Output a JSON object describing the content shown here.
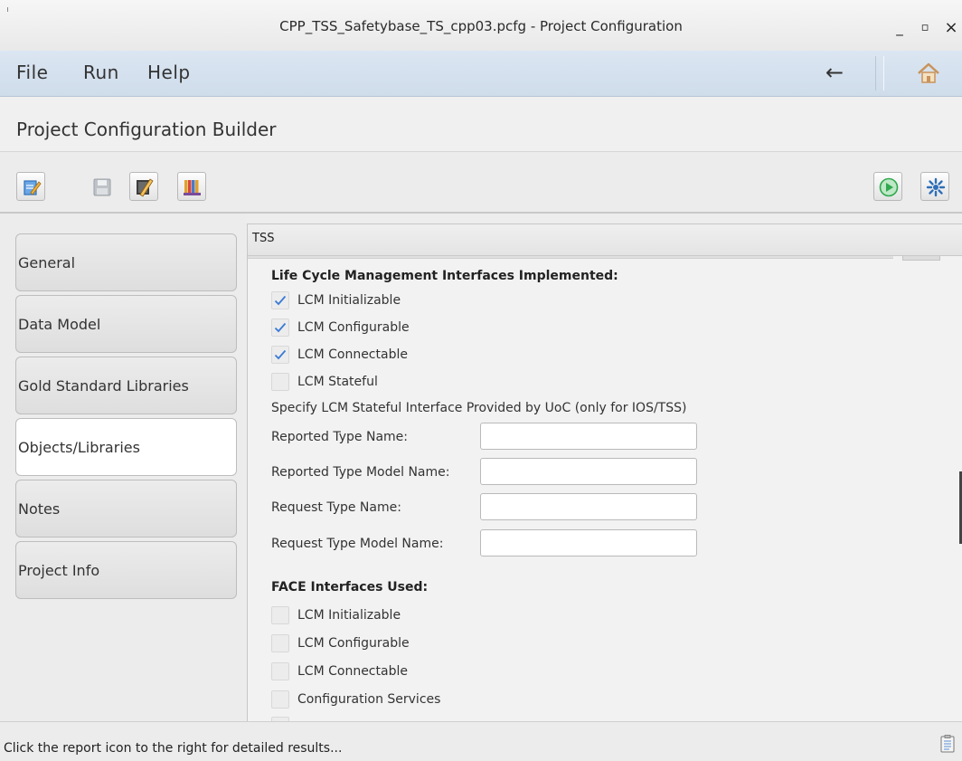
{
  "window": {
    "title": "CPP_TSS_Safetybase_TS_cpp03.pcfg - Project Configuration",
    "minimize": "_",
    "maximize": "▫",
    "close": "×"
  },
  "menubar": {
    "items": [
      "File",
      "Run",
      "Help"
    ],
    "back": "←"
  },
  "header": {
    "title": "Project Configuration Builder"
  },
  "nav": {
    "items": [
      {
        "label": "General",
        "active": false
      },
      {
        "label": "Data Model",
        "active": false
      },
      {
        "label": "Gold Standard Libraries",
        "active": false
      },
      {
        "label": "Objects/Libraries",
        "active": true
      },
      {
        "label": "Notes",
        "active": false
      },
      {
        "label": "Project Info",
        "active": false
      }
    ]
  },
  "panel": {
    "tab": "TSS",
    "lcm_section": {
      "title": "Life Cycle Management Interfaces Implemented:",
      "checkboxes": [
        {
          "label": "LCM Initializable",
          "checked": true
        },
        {
          "label": "LCM Configurable",
          "checked": true
        },
        {
          "label": "LCM Connectable",
          "checked": true
        },
        {
          "label": "LCM Stateful",
          "checked": false
        }
      ],
      "stateful_note": "Specify LCM Stateful Interface Provided by UoC (only for IOS/TSS)",
      "fields": [
        {
          "label": "Reported Type Name:",
          "value": ""
        },
        {
          "label": "Reported Type Model Name:",
          "value": ""
        },
        {
          "label": "Request Type Name:",
          "value": ""
        },
        {
          "label": "Request Type Model Name:",
          "value": ""
        }
      ]
    },
    "face_section": {
      "title": "FACE Interfaces Used:",
      "checkboxes": [
        {
          "label": "LCM Initializable",
          "checked": false
        },
        {
          "label": "LCM Configurable",
          "checked": false
        },
        {
          "label": "LCM Connectable",
          "checked": false
        },
        {
          "label": "Configuration Services",
          "checked": false
        }
      ]
    }
  },
  "status": {
    "message": "Click the report icon to the right for detailed results..."
  },
  "colors": {
    "check": "#3a7bd5",
    "run_green": "#2fa84f",
    "menubar": "#d4e0ec"
  },
  "icons": {
    "toolbar_left": [
      "edit-config-icon",
      "save-icon",
      "edit-file-icon",
      "library-icon"
    ],
    "toolbar_right": [
      "run-icon",
      "settings-icon"
    ],
    "menubar": [
      "back-arrow-icon",
      "home-icon"
    ],
    "status": [
      "report-icon"
    ]
  }
}
